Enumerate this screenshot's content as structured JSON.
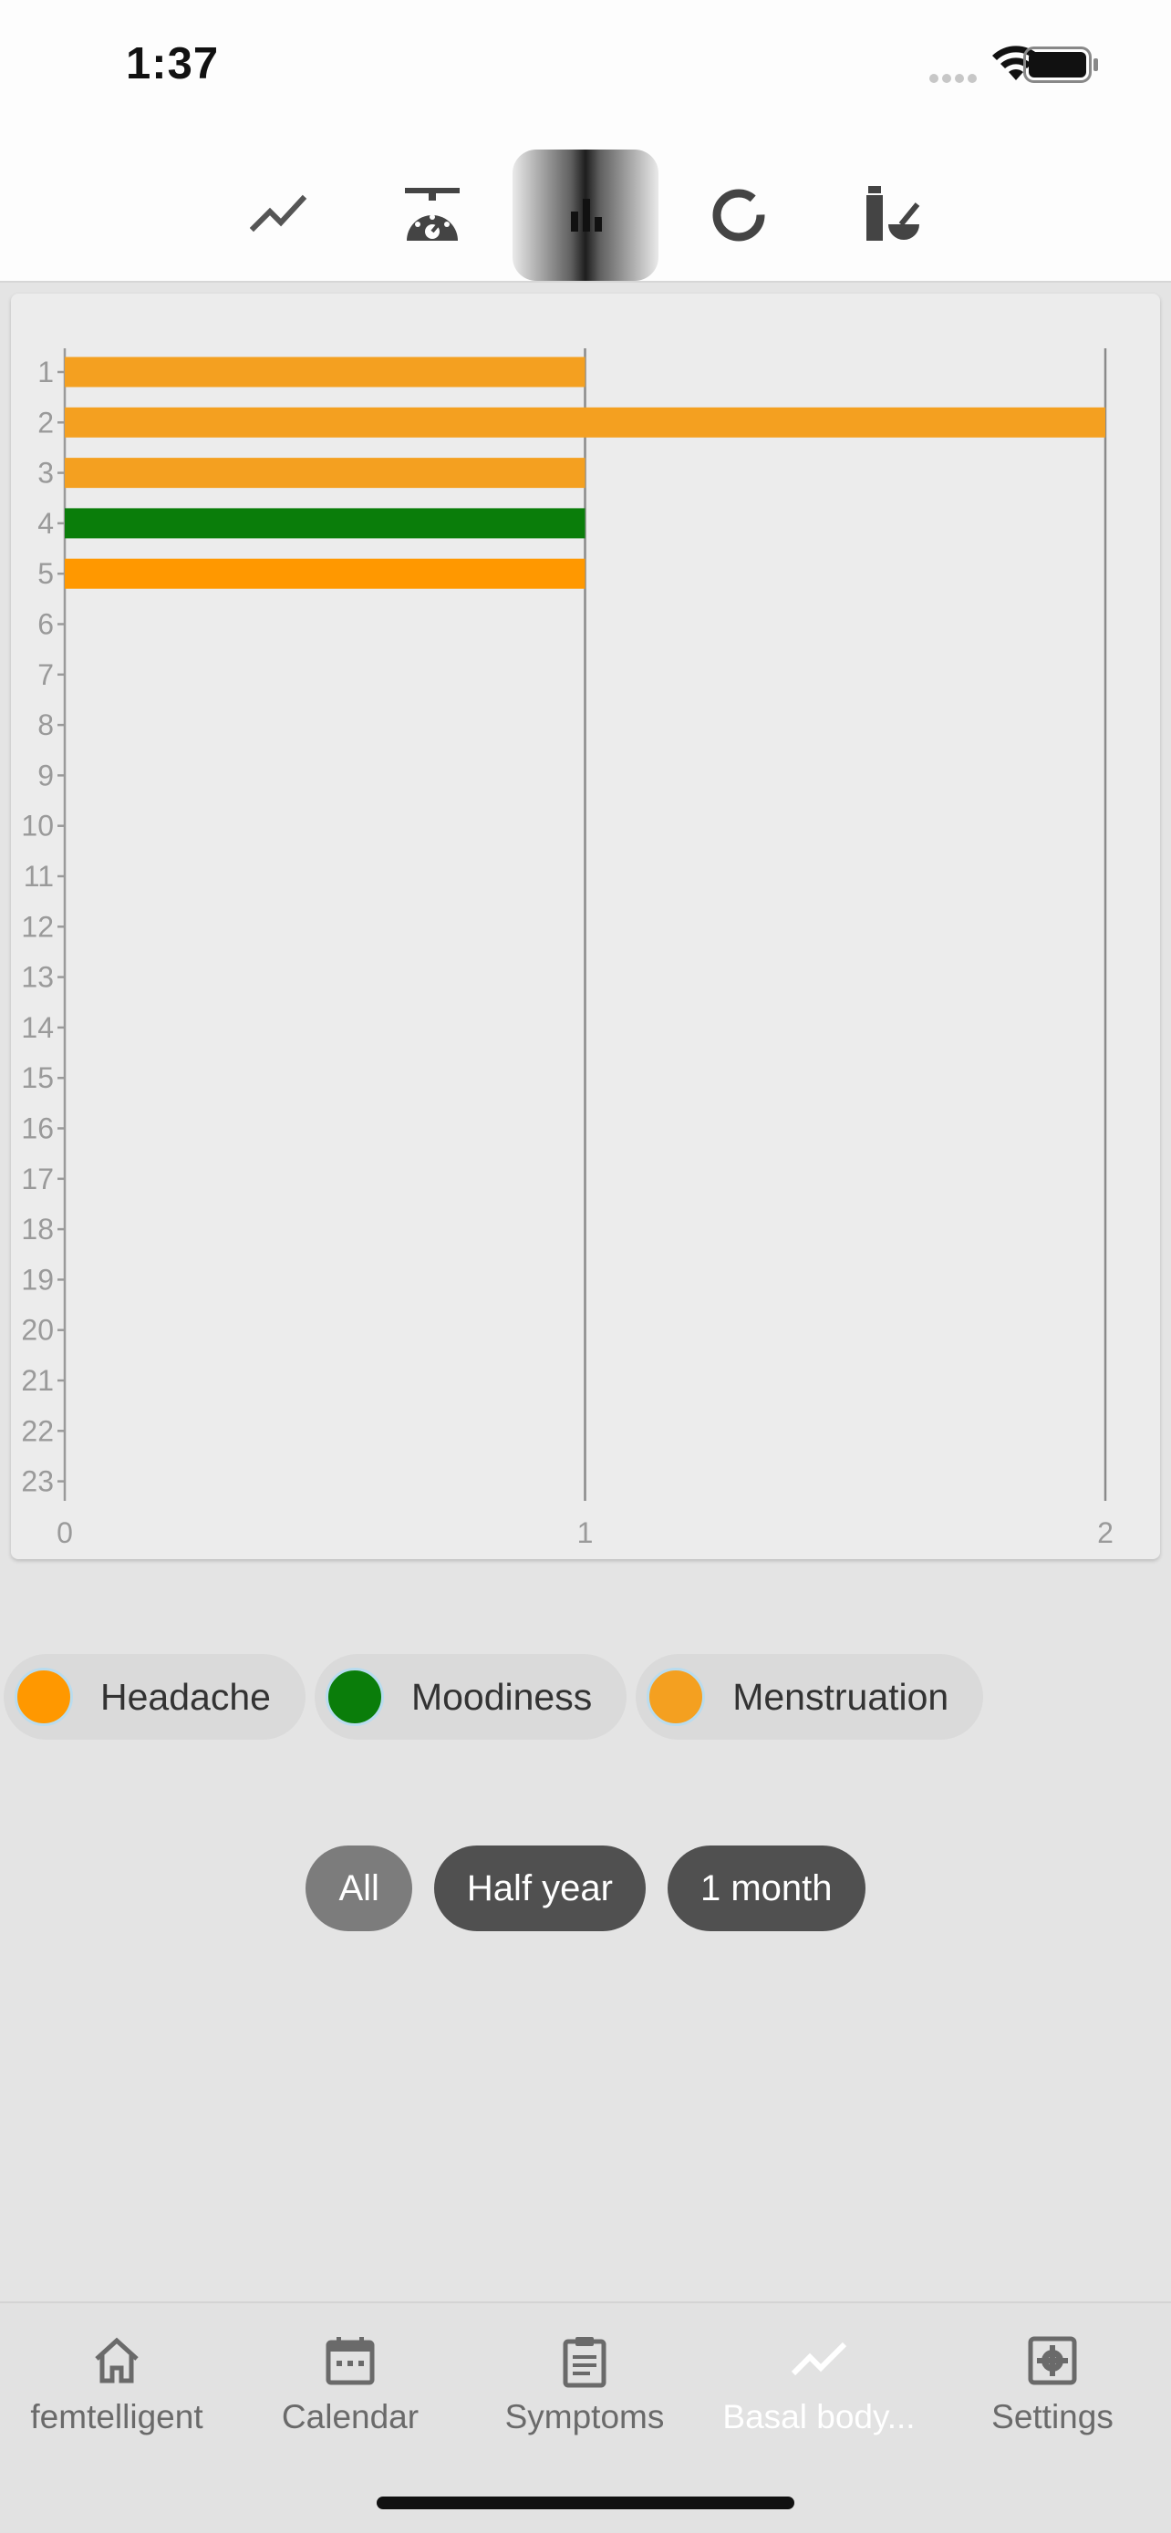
{
  "status_bar": {
    "time": "1:37"
  },
  "top_tabs": [
    {
      "icon": "line-chart-icon",
      "active": false
    },
    {
      "icon": "scale-icon",
      "active": false
    },
    {
      "icon": "bar-chart-icon",
      "active": true
    },
    {
      "icon": "donut-chart-icon",
      "active": false
    },
    {
      "icon": "mortar-pestle-icon",
      "active": false
    }
  ],
  "chart_data": {
    "type": "bar",
    "orientation": "horizontal",
    "categories": [
      "1",
      "2",
      "3",
      "4",
      "5",
      "6",
      "7",
      "8",
      "9",
      "10",
      "11",
      "12",
      "13",
      "14",
      "15",
      "16",
      "17",
      "18",
      "19",
      "20",
      "21",
      "22",
      "23"
    ],
    "x_ticks": [
      "0",
      "1",
      "2"
    ],
    "xlim": [
      0,
      2
    ],
    "grid": "vertical",
    "bars": [
      {
        "category": "1",
        "value": 1,
        "series": "Menstruation",
        "color": "#f4a020"
      },
      {
        "category": "2",
        "value": 2,
        "series": "Menstruation",
        "color": "#f4a020"
      },
      {
        "category": "3",
        "value": 1,
        "series": "Menstruation",
        "color": "#f4a020"
      },
      {
        "category": "4",
        "value": 1,
        "series": "Moodiness",
        "color": "#0a7d0a"
      },
      {
        "category": "5",
        "value": 1,
        "series": "Headache",
        "color": "#ff9800"
      }
    ]
  },
  "legend": [
    {
      "label": "Headache",
      "color": "#ff9800"
    },
    {
      "label": "Moodiness",
      "color": "#0a7d0a"
    },
    {
      "label": "Menstruation",
      "color": "#f4a020"
    }
  ],
  "period_filters": [
    {
      "label": "All",
      "selected": true
    },
    {
      "label": "Half year",
      "selected": false
    },
    {
      "label": "1 month",
      "selected": false
    }
  ],
  "bottom_nav": [
    {
      "label": "femtelligent",
      "icon": "home-icon",
      "active": false
    },
    {
      "label": "Calendar",
      "icon": "calendar-icon",
      "active": false
    },
    {
      "label": "Symptoms",
      "icon": "clipboard-icon",
      "active": false
    },
    {
      "label": "Basal body...",
      "icon": "line-chart-icon",
      "active": true
    },
    {
      "label": "Settings",
      "icon": "settings-icon",
      "active": false
    }
  ]
}
